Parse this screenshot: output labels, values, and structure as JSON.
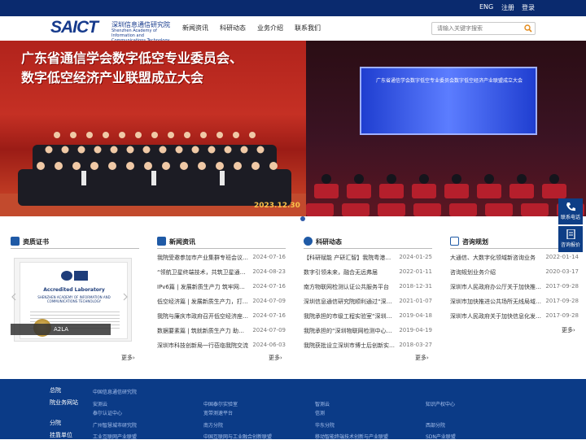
{
  "topbar": {
    "lang": "ENG",
    "register": "注册",
    "login": "登录"
  },
  "header": {
    "logo_mark": "SAICT",
    "logo_cn": "深圳信息通信研究院",
    "logo_en": "Shenzhen Academy of Information and Communications Technology",
    "nav": [
      "新闻资讯",
      "科研动态",
      "业务介绍",
      "联系我们"
    ],
    "search_placeholder": "请输入关键字搜索"
  },
  "banner": {
    "title_line1": "广东省通信学会数字低空专业委员会、",
    "title_line2": "数字低空经济产业联盟成立大会",
    "stage_text": "广东省通信学会数字低空专业委员会数字低空经济产业联盟成立大会",
    "date": "2023.12.30"
  },
  "sections": {
    "cert": {
      "title": "资质证书",
      "cert_title": "Accredited Laboratory",
      "cert_sub": "SHENZHEN ACADEMY OF INFORMATION AND COMMUNICATIONS TECHNOLOGY",
      "caption": "A2LA"
    },
    "news": {
      "title": "新闻资讯",
      "items": [
        {
          "title": "我院受邀参加市产业集群专班会议…",
          "date": "2024-07-16"
        },
        {
          "title": "“领航卫星终端技术，共筑卫星通信…",
          "date": "2024-08-23"
        },
        {
          "title": "IPv6篇 | 发展新质生产力 筑牢网络…",
          "date": "2024-07-16"
        },
        {
          "title": "低空经济篇 | 发展新质生产力，打…",
          "date": "2024-07-09"
        },
        {
          "title": "我院与廉庆市政府召开低空经济座…",
          "date": "2024-07-16"
        },
        {
          "title": "数据要素篇 | 筑就新质生产力 助力…",
          "date": "2024-07-09"
        },
        {
          "title": "深圳市科技创新局一行莅临我院交流",
          "date": "2024-06-03"
        }
      ],
      "more": "更多›"
    },
    "research": {
      "title": "科研动态",
      "items": [
        {
          "title": "【科研赋能 产研汇智】我院粤港大…",
          "date": "2024-01-25"
        },
        {
          "title": "数字引领未来，融合无远弗届",
          "date": "2022-01-11"
        },
        {
          "title": "南方物联网检测认证公共服务平台",
          "date": "2018-12-31"
        },
        {
          "title": "深圳信息通信研究院顺利通过“深圳…",
          "date": "2021-01-07"
        },
        {
          "title": "我院承担的市级工程实验室“深圳…",
          "date": "2019-04-18"
        },
        {
          "title": "我院承担的“深圳物联网检测中心…",
          "date": "2019-04-19"
        },
        {
          "title": "我院获批设立深圳市博士后创新实…",
          "date": "2018-03-27"
        }
      ],
      "more": "更多›"
    },
    "consult": {
      "title": "咨询规划",
      "items": [
        {
          "title": "大通信、大数字化领域新咨询业务",
          "date": "2022-01-14"
        },
        {
          "title": "咨询规划业务介绍",
          "date": "2020-03-17"
        },
        {
          "title": "深圳市人民政府办公厅关于加快推…",
          "date": "2017-09-28"
        },
        {
          "title": "深圳市加快推进公共场所无线局域…",
          "date": "2017-09-28"
        },
        {
          "title": "深圳市人民政府关于加快信息化发…",
          "date": "2017-09-28"
        }
      ],
      "more": "更多›"
    }
  },
  "side_buttons": [
    "联系电话",
    "咨询报价"
  ],
  "footer": {
    "labels": [
      "总院",
      "院业务网站",
      "分院",
      "挂靠单位"
    ],
    "row0": [
      "中国信息通信研究院"
    ],
    "row1a": [
      "安测云",
      "中国泰尔实验室",
      "智测云",
      "知识产权中心"
    ],
    "row1b": [
      "泰尔认证中心",
      "宽带测速平台",
      "信测"
    ],
    "row2": [
      "广州智慧城市研究院",
      "南方分院",
      "华东分院",
      "西部分院"
    ],
    "row3": [
      "工业互联网产业联盟",
      "中国互联网与工业融合创新联盟",
      "移动智能终端技术创新与产业联盟",
      "SDN产业联盟"
    ]
  },
  "colors": {
    "primary": "#0b3b87",
    "topbar": "#0a2a6e",
    "accent": "#1f5aa6"
  }
}
